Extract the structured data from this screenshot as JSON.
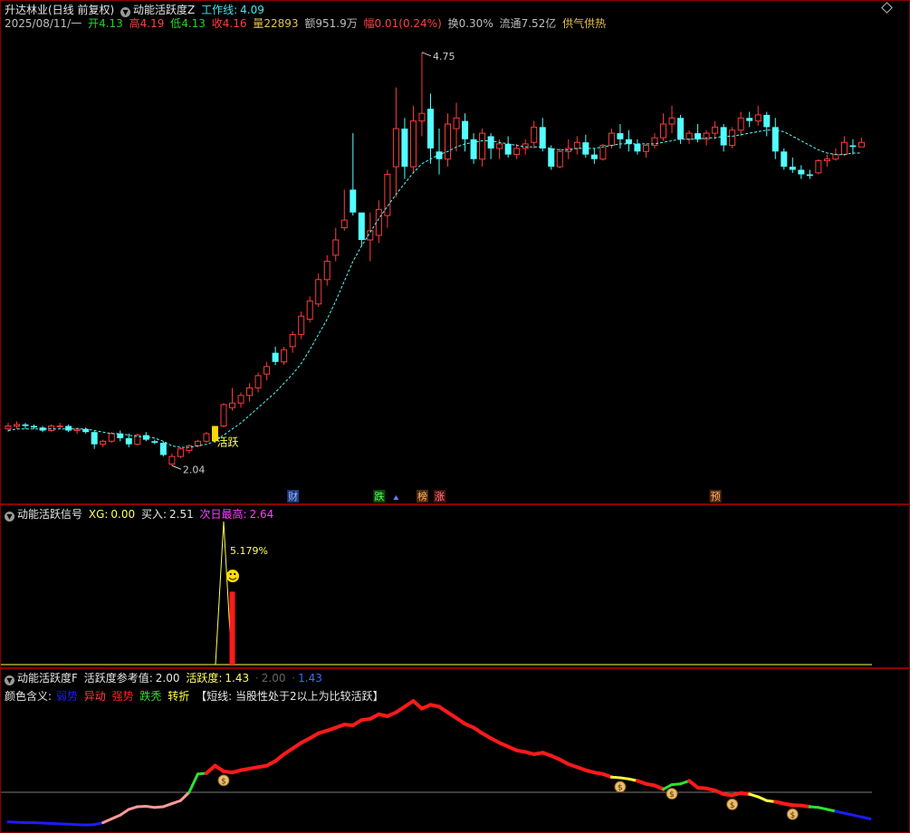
{
  "main_panel": {
    "title": "升达林业(日线 前复权)",
    "indicator_name": "动能活跃度Z",
    "indicator_value_label": "工作线:",
    "indicator_value": "4.09",
    "info": {
      "date": "2025/08/11/一",
      "open_label": "开",
      "open": "4.13",
      "high_label": "高",
      "high": "4.19",
      "low_label": "低",
      "low": "4.13",
      "close_label": "收",
      "close": "4.16",
      "volume_label": "量",
      "volume": "22893",
      "amount_label": "额",
      "amount": "951.9万",
      "change_label": "幅",
      "change": "0.01(0.24%)",
      "turnover_label": "换",
      "turnover": "0.30%",
      "float_label": "流通",
      "float": "7.52亿",
      "concept": "供气供热"
    },
    "annotations": {
      "max_price": "4.75",
      "min_price": "2.04",
      "active_label": "活跃"
    },
    "event_markers": [
      "财",
      "跌",
      "榜",
      "涨",
      "预"
    ]
  },
  "signal_panel": {
    "title": "动能活跃信号",
    "xg_label": "XG:",
    "xg_value": "0.00",
    "buy_label": "买入:",
    "buy_value": "2.51",
    "next_high_label": "次日最高:",
    "next_high_value": "2.64",
    "peak_percent": "5.179%",
    "smiley": "☻"
  },
  "activity_panel": {
    "title": "动能活跃度F",
    "ref_label": "活跃度参考值:",
    "ref_value": "2.00",
    "act_label": "活跃度:",
    "act_value": "1.43",
    "extra1": "2.00",
    "extra2": "1.43",
    "legend_prefix": "颜色含义:",
    "legend_items": [
      {
        "label": "弱势",
        "color": "#1c1cff"
      },
      {
        "label": "异动",
        "color": "#ff4040"
      },
      {
        "label": "强势",
        "color": "#ff2020"
      },
      {
        "label": "跌秃",
        "color": "#30e030"
      },
      {
        "label": "转折",
        "color": "#ffff40"
      }
    ],
    "note": "【短线: 当股性处于2以上为比较活跃】",
    "moneybag": "$"
  },
  "colors": {
    "up": "#ff3b3b",
    "down": "#54ffff",
    "ma": "#54ffff",
    "frame": "#8b0000"
  },
  "chart_data": {
    "type": "candlestick",
    "ylim": [
      2.0,
      4.85
    ],
    "ohlc": [
      [
        2.28,
        2.32,
        2.26,
        2.3
      ],
      [
        2.3,
        2.33,
        2.28,
        2.31
      ],
      [
        2.31,
        2.32,
        2.28,
        2.3
      ],
      [
        2.3,
        2.31,
        2.28,
        2.29
      ],
      [
        2.29,
        2.3,
        2.26,
        2.27
      ],
      [
        2.27,
        2.31,
        2.26,
        2.3
      ],
      [
        2.3,
        2.32,
        2.28,
        2.3
      ],
      [
        2.3,
        2.31,
        2.26,
        2.27
      ],
      [
        2.27,
        2.29,
        2.25,
        2.28
      ],
      [
        2.28,
        2.29,
        2.25,
        2.26
      ],
      [
        2.26,
        2.27,
        2.15,
        2.18
      ],
      [
        2.18,
        2.21,
        2.16,
        2.2
      ],
      [
        2.2,
        2.26,
        2.19,
        2.25
      ],
      [
        2.25,
        2.27,
        2.2,
        2.22
      ],
      [
        2.22,
        2.25,
        2.16,
        2.18
      ],
      [
        2.18,
        2.25,
        2.17,
        2.24
      ],
      [
        2.24,
        2.26,
        2.2,
        2.21
      ],
      [
        2.2,
        2.21,
        2.18,
        2.19
      ],
      [
        2.19,
        2.2,
        2.1,
        2.11
      ],
      [
        2.05,
        2.12,
        2.04,
        2.1
      ],
      [
        2.1,
        2.16,
        2.09,
        2.15
      ],
      [
        2.14,
        2.18,
        2.12,
        2.17
      ],
      [
        2.17,
        2.21,
        2.16,
        2.2
      ],
      [
        2.2,
        2.26,
        2.19,
        2.25
      ],
      [
        2.2,
        2.3,
        2.19,
        2.3
      ],
      [
        2.3,
        2.45,
        2.29,
        2.44
      ],
      [
        2.42,
        2.55,
        2.4,
        2.45
      ],
      [
        2.45,
        2.52,
        2.42,
        2.5
      ],
      [
        2.5,
        2.58,
        2.46,
        2.55
      ],
      [
        2.55,
        2.65,
        2.52,
        2.63
      ],
      [
        2.64,
        2.72,
        2.6,
        2.69
      ],
      [
        2.78,
        2.82,
        2.7,
        2.72
      ],
      [
        2.72,
        2.82,
        2.7,
        2.8
      ],
      [
        2.82,
        2.92,
        2.78,
        2.9
      ],
      [
        2.9,
        3.05,
        2.87,
        3.02
      ],
      [
        3.0,
        3.15,
        2.98,
        3.12
      ],
      [
        3.1,
        3.3,
        3.08,
        3.26
      ],
      [
        3.26,
        3.42,
        3.22,
        3.38
      ],
      [
        3.42,
        3.6,
        3.38,
        3.52
      ],
      [
        3.6,
        3.85,
        3.58,
        3.65
      ],
      [
        3.85,
        4.22,
        3.68,
        3.7
      ],
      [
        3.7,
        3.48,
        3.55,
        3.52
      ],
      [
        3.52,
        3.7,
        3.38,
        3.58
      ],
      [
        3.55,
        3.78,
        3.5,
        3.72
      ],
      [
        3.68,
        3.98,
        3.6,
        3.95
      ],
      [
        4.0,
        4.52,
        3.8,
        4.25
      ],
      [
        4.25,
        4.32,
        3.92,
        4.0
      ],
      [
        4.0,
        4.4,
        3.96,
        4.3
      ],
      [
        4.3,
        4.75,
        4.2,
        4.35
      ],
      [
        4.38,
        4.48,
        4.02,
        4.12
      ],
      [
        4.1,
        4.25,
        3.95,
        4.05
      ],
      [
        4.05,
        4.35,
        4.0,
        4.28
      ],
      [
        4.25,
        4.42,
        4.1,
        4.32
      ],
      [
        4.3,
        4.35,
        4.1,
        4.18
      ],
      [
        4.18,
        4.22,
        4.02,
        4.05
      ],
      [
        4.05,
        4.25,
        4.0,
        4.22
      ],
      [
        4.2,
        4.22,
        4.05,
        4.12
      ],
      [
        4.12,
        4.18,
        4.05,
        4.15
      ],
      [
        4.15,
        4.2,
        4.06,
        4.08
      ],
      [
        4.08,
        4.15,
        4.05,
        4.12
      ],
      [
        4.12,
        4.18,
        4.08,
        4.15
      ],
      [
        4.16,
        4.3,
        4.12,
        4.26
      ],
      [
        4.26,
        4.32,
        4.1,
        4.12
      ],
      [
        4.12,
        4.14,
        3.98,
        4.0
      ],
      [
        4.0,
        4.12,
        3.99,
        4.1
      ],
      [
        4.1,
        4.18,
        4.05,
        4.12
      ],
      [
        4.12,
        4.2,
        4.08,
        4.16
      ],
      [
        4.16,
        4.21,
        4.06,
        4.08
      ],
      [
        4.08,
        4.12,
        4.02,
        4.05
      ],
      [
        4.05,
        4.15,
        4.04,
        4.14
      ],
      [
        4.14,
        4.25,
        4.12,
        4.22
      ],
      [
        4.22,
        4.28,
        4.12,
        4.18
      ],
      [
        4.18,
        4.24,
        4.1,
        4.15
      ],
      [
        4.15,
        4.18,
        4.08,
        4.1
      ],
      [
        4.1,
        4.15,
        4.06,
        4.14
      ],
      [
        4.14,
        4.22,
        4.12,
        4.19
      ],
      [
        4.19,
        4.35,
        4.17,
        4.28
      ],
      [
        4.28,
        4.4,
        4.22,
        4.32
      ],
      [
        4.32,
        4.34,
        4.15,
        4.18
      ],
      [
        4.18,
        4.24,
        4.15,
        4.22
      ],
      [
        4.22,
        4.28,
        4.16,
        4.18
      ],
      [
        4.18,
        4.24,
        4.14,
        4.22
      ],
      [
        4.22,
        4.3,
        4.18,
        4.26
      ],
      [
        4.26,
        4.28,
        4.1,
        4.14
      ],
      [
        4.14,
        4.26,
        4.12,
        4.24
      ],
      [
        4.24,
        4.36,
        4.2,
        4.32
      ],
      [
        4.32,
        4.36,
        4.26,
        4.3
      ],
      [
        4.3,
        4.4,
        4.27,
        4.34
      ],
      [
        4.34,
        4.36,
        4.2,
        4.26
      ],
      [
        4.26,
        4.32,
        4.05,
        4.1
      ],
      [
        4.1,
        4.12,
        3.98,
        4.0
      ],
      [
        4.0,
        4.06,
        3.96,
        3.98
      ],
      [
        3.98,
        4.01,
        3.92,
        3.95
      ],
      [
        3.95,
        3.98,
        3.92,
        3.94
      ],
      [
        3.96,
        4.05,
        3.95,
        4.04
      ],
      [
        4.04,
        4.08,
        4.0,
        4.05
      ],
      [
        4.05,
        4.12,
        4.04,
        4.08
      ],
      [
        4.08,
        4.2,
        4.07,
        4.16
      ],
      [
        4.14,
        4.18,
        4.08,
        4.13
      ],
      [
        4.13,
        4.19,
        4.13,
        4.16
      ]
    ],
    "ma": [
      2.27,
      2.28,
      2.28,
      2.28,
      2.28,
      2.28,
      2.28,
      2.28,
      2.28,
      2.28,
      2.27,
      2.26,
      2.25,
      2.25,
      2.24,
      2.23,
      2.23,
      2.22,
      2.2,
      2.17,
      2.16,
      2.16,
      2.17,
      2.18,
      2.2,
      2.24,
      2.28,
      2.32,
      2.37,
      2.42,
      2.47,
      2.52,
      2.58,
      2.64,
      2.71,
      2.8,
      2.9,
      3.0,
      3.12,
      3.25,
      3.38,
      3.48,
      3.57,
      3.66,
      3.74,
      3.82,
      3.89,
      3.96,
      4.02,
      4.05,
      4.08,
      4.1,
      4.13,
      4.15,
      4.16,
      4.17,
      4.17,
      4.16,
      4.15,
      4.14,
      4.13,
      4.13,
      4.13,
      4.12,
      4.11,
      4.11,
      4.12,
      4.12,
      4.12,
      4.13,
      4.14,
      4.15,
      4.15,
      4.15,
      4.15,
      4.15,
      4.16,
      4.17,
      4.18,
      4.18,
      4.18,
      4.19,
      4.19,
      4.2,
      4.2,
      4.21,
      4.22,
      4.23,
      4.24,
      4.24,
      4.23,
      4.2,
      4.17,
      4.14,
      4.11,
      4.09,
      4.08,
      4.08,
      4.09,
      4.09
    ],
    "signal": {
      "peak_index": 25,
      "bar_index": 26,
      "peak_value": 5.179,
      "bar_value": 2.64
    },
    "activity": [
      0.22,
      0.21,
      0.2,
      0.2,
      0.19,
      0.18,
      0.17,
      0.16,
      0.15,
      0.14,
      0.15,
      0.2,
      0.3,
      0.4,
      0.55,
      0.62,
      0.63,
      0.6,
      0.62,
      0.7,
      0.78,
      1.0,
      1.48,
      1.5,
      1.7,
      1.55,
      1.52,
      1.58,
      1.62,
      1.66,
      1.7,
      1.82,
      2.0,
      2.15,
      2.3,
      2.42,
      2.55,
      2.62,
      2.7,
      2.78,
      2.76,
      2.9,
      2.93,
      3.05,
      3.0,
      3.1,
      3.25,
      3.4,
      3.2,
      3.3,
      3.25,
      3.1,
      2.95,
      2.8,
      2.7,
      2.55,
      2.42,
      2.3,
      2.2,
      2.1,
      2.06,
      2.0,
      2.04,
      1.96,
      1.86,
      1.74,
      1.66,
      1.58,
      1.52,
      1.48,
      1.4,
      1.38,
      1.35,
      1.3,
      1.22,
      1.18,
      1.08,
      1.2,
      1.22,
      1.3,
      1.12,
      1.1,
      1.05,
      0.95,
      0.92,
      0.98,
      0.95,
      0.88,
      0.78,
      0.75,
      0.7,
      0.66,
      0.65,
      0.62,
      0.6,
      0.55,
      0.5,
      0.45,
      0.4,
      0.35,
      0.3
    ],
    "activity_ref": 1.0,
    "activity_ylim": [
      0.0,
      4.0
    ]
  }
}
